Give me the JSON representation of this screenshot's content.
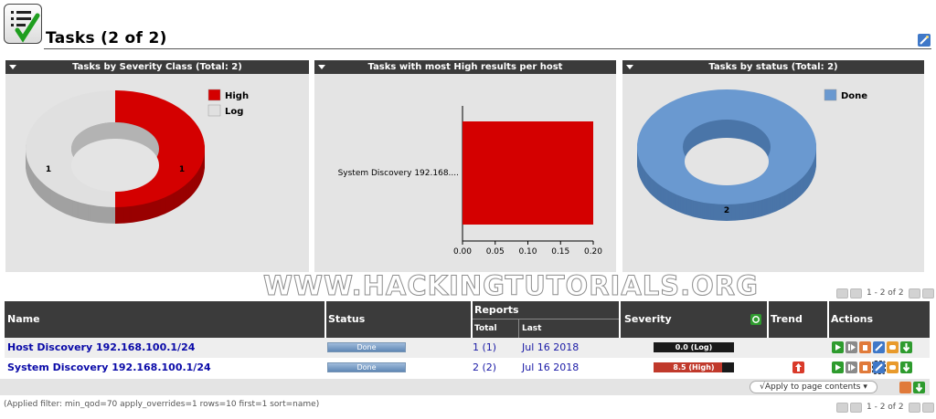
{
  "header": {
    "title": "Tasks (2 of 2)"
  },
  "colors": {
    "high": "#d40000",
    "log": "#e0e0e0",
    "done": "#6a99d0",
    "done_dark": "#4a75a8",
    "panel_head": "#3b3b3b"
  },
  "panels": [
    {
      "title": "Tasks by Severity Class (Total: 2)"
    },
    {
      "title": "Tasks with most High results per host"
    },
    {
      "title": "Tasks by status (Total: 2)"
    }
  ],
  "chart_data": [
    {
      "type": "pie",
      "title": "Tasks by Severity Class (Total: 2)",
      "categories": [
        "High",
        "Log"
      ],
      "values": [
        1,
        1
      ],
      "colors": [
        "#d40000",
        "#e0e0e0"
      ],
      "legend": "top-right"
    },
    {
      "type": "bar",
      "orientation": "horizontal",
      "title": "Tasks with most High results per host",
      "categories": [
        "System Discovery 192.168...."
      ],
      "values": [
        0.2
      ],
      "xlim": [
        0,
        0.2
      ],
      "xticks": [
        "0.00",
        "0.05",
        "0.10",
        "0.15",
        "0.20"
      ],
      "colors": [
        "#d40000"
      ]
    },
    {
      "type": "pie",
      "title": "Tasks by status (Total: 2)",
      "categories": [
        "Done"
      ],
      "values": [
        2
      ],
      "colors": [
        "#6a99d0"
      ],
      "legend": "top-right"
    }
  ],
  "watermark": "WWW.HACKINGTUTORIALS.ORG",
  "pager": {
    "text": "1 - 2 of 2"
  },
  "table": {
    "headers": {
      "name": "Name",
      "status": "Status",
      "reports": "Reports",
      "total": "Total",
      "last": "Last",
      "severity": "Severity",
      "trend": "Trend",
      "actions": "Actions"
    },
    "rows": [
      {
        "name": "Host Discovery 192.168.100.1/24",
        "status": "Done",
        "total": "1 (1)",
        "last": "Jul 16 2018",
        "severity": "0.0 (Log)",
        "severity_score": 0.0,
        "trend": ""
      },
      {
        "name": "System Discovery 192.168.100.1/24",
        "status": "Done",
        "total": "2 (2)",
        "last": "Jul 16 2018",
        "severity": "8.5 (High)",
        "severity_score": 8.5,
        "trend": "up"
      }
    ]
  },
  "apply_select": "√Apply to page contents",
  "filter": "(Applied filter: min_qod=70 apply_overrides=1 rows=10 first=1 sort=name)"
}
